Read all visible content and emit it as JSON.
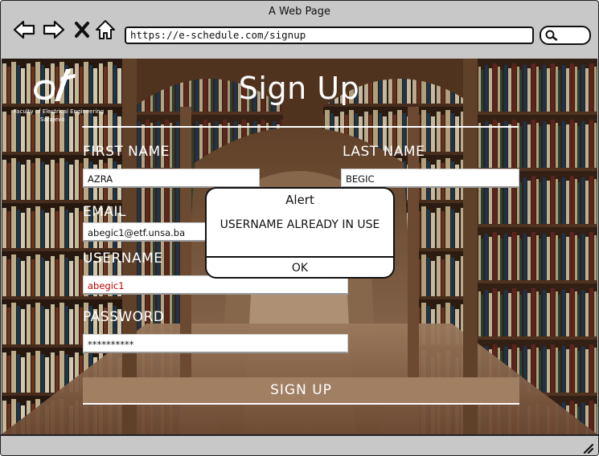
{
  "browser": {
    "title": "A Web Page",
    "url": "https://e-schedule.com/signup",
    "icons": [
      "back-arrow-icon",
      "forward-arrow-icon",
      "close-x-icon",
      "home-icon",
      "search-icon",
      "resize-grip-icon"
    ]
  },
  "logo": {
    "line1": "Faculty of Electrical Engineering",
    "line2": "Sarajevo"
  },
  "page": {
    "heading": "Sign Up",
    "first_name_label": "FIRST NAME",
    "last_name_label": "LAST NAME",
    "email_label": "EMAIL",
    "username_label": "USERNAME",
    "password_label": "PASSWORD",
    "first_name_value": "AZRA",
    "last_name_value": "BEGIC",
    "email_value": "abegic1@etf.unsa.ba",
    "username_value": "abegic1",
    "password_value": "**********",
    "submit_label": "SIGN UP"
  },
  "alert": {
    "title": "Alert",
    "message": "USERNAME ALREADY IN USE",
    "ok_label": "OK"
  },
  "colors": {
    "button_brown": "#a07f63",
    "error_red": "#c00000"
  }
}
